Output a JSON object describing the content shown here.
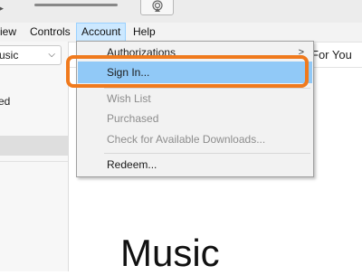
{
  "menubar": {
    "items": [
      "iew",
      "Controls",
      "Account",
      "Help"
    ]
  },
  "sidebar": {
    "media_select": "usic",
    "media_chevron": "⌵",
    "section_text": "ed"
  },
  "main": {
    "tab_for_you": "For You",
    "page_title": "Music"
  },
  "account_menu": {
    "items": [
      {
        "label": "Authorizations",
        "enabled": true,
        "submenu": true
      },
      {
        "label": "Sign In...",
        "enabled": true,
        "highlighted": true
      },
      {
        "label": "Wish List",
        "enabled": false
      },
      {
        "label": "Purchased",
        "enabled": false
      },
      {
        "label": "Check for Available Downloads...",
        "enabled": false
      },
      {
        "label": "Redeem...",
        "enabled": true
      }
    ],
    "submenu_arrow": ">"
  },
  "colors": {
    "highlight": "#91c9f7",
    "callout": "#f07a1d",
    "menu_active": "#cce8ff"
  }
}
